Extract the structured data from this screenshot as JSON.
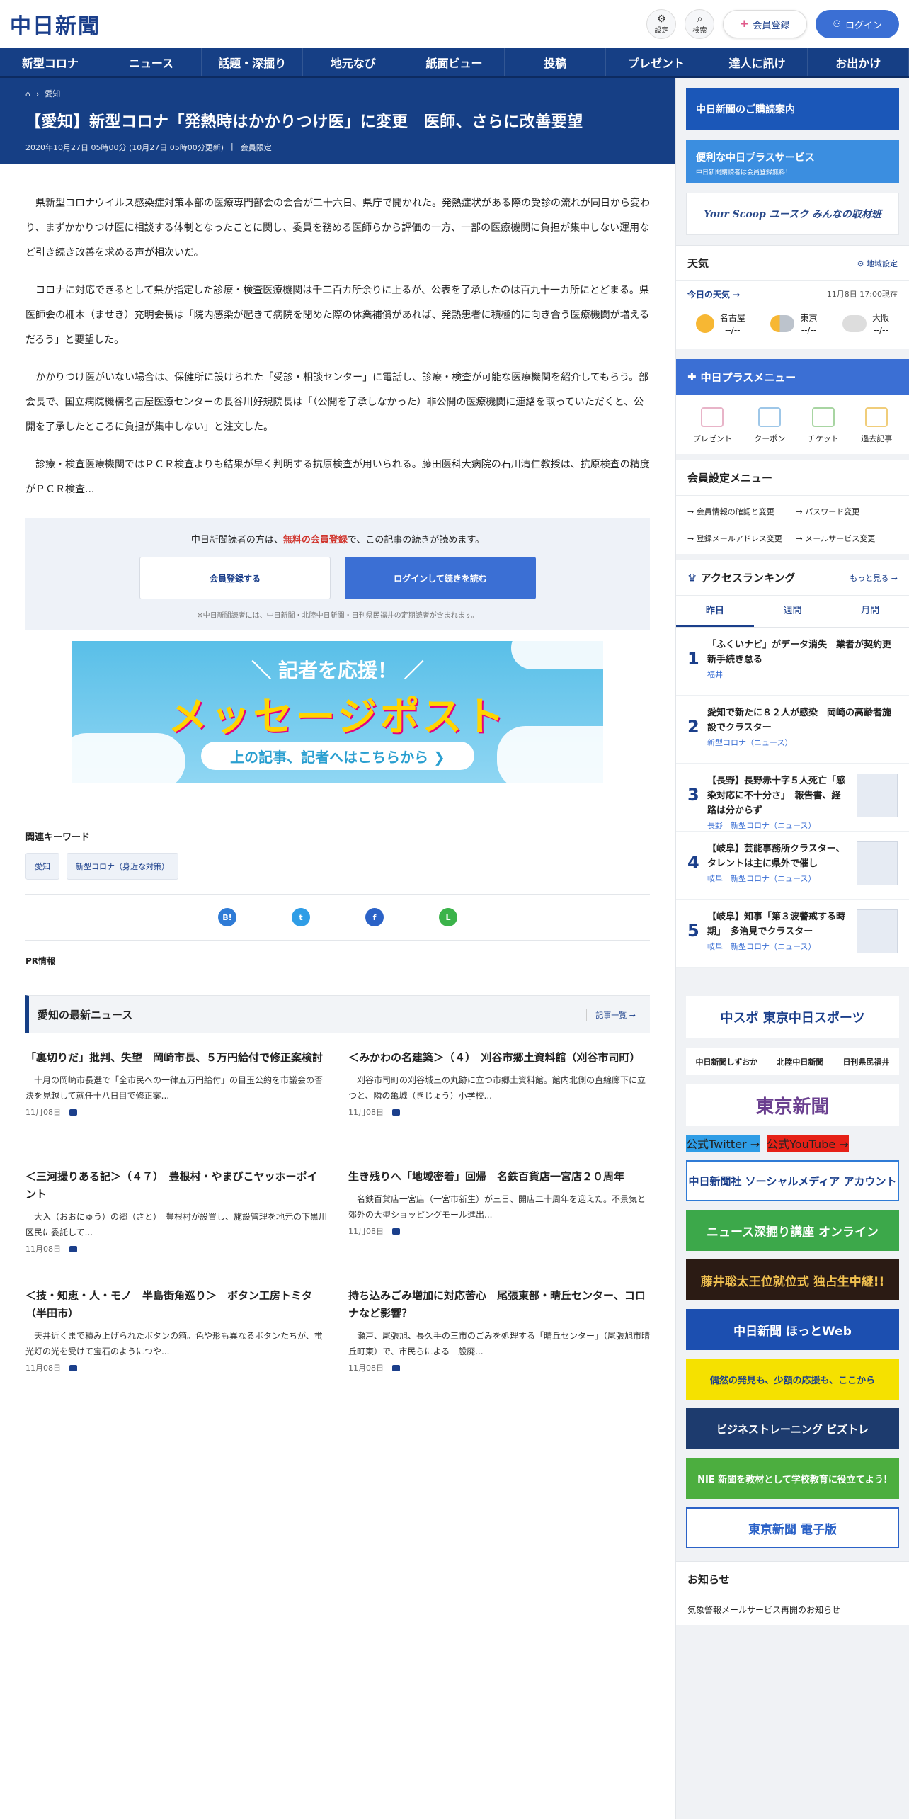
{
  "header": {
    "logo": "中日新聞",
    "settings_label": "設定",
    "search_label": "検索",
    "register_label": "会員登録",
    "login_label": "ログイン"
  },
  "nav": [
    "新型コロナ",
    "ニュース",
    "話題・深掘り",
    "地元なび",
    "紙面ビュー",
    "投稿",
    "プレゼント",
    "達人に訊け",
    "お出かけ"
  ],
  "breadcrumb": [
    "愛知"
  ],
  "article": {
    "title": "【愛知】新型コロナ「発熱時はかかりつけ医」に変更　医師、さらに改善要望",
    "date": "2020年10月27日 05時00分 (10月27日 05時00分更新)",
    "badge": "会員限定",
    "paragraphs": [
      "県新型コロナウイルス感染症対策本部の医療専門部会の会合が二十六日、県庁で開かれた。発熱症状がある際の受診の流れが同日から変わり、まずかかりつけ医に相談する体制となったことに関し、委員を務める医師らから評価の一方、一部の医療機関に負担が集中しない運用など引き続き改善を求める声が相次いだ。",
      "コロナに対応できるとして県が指定した診療・検査医療機関は千二百カ所余りに上るが、公表を了承したのは百九十一カ所にとどまる。県医師会の柵木（ませき）充明会長は「院内感染が起きて病院を閉めた際の休業補償があれば、発熱患者に積極的に向き合う医療機関が増えるだろう」と要望した。",
      "かかりつけ医がいない場合は、保健所に設けられた「受診・相談センター」に電話し、診療・検査が可能な医療機関を紹介してもらう。部会長で、国立病院機構名古屋医療センターの長谷川好規院長は「（公開を了承しなかった）非公開の医療機関に連絡を取っていただくと、公開を了承したところに負担が集中しない」と注文した。",
      "診療・検査医療機関ではＰＣＲ検査よりも結果が早く判明する抗原検査が用いられる。藤田医科大病院の石川清仁教授は、抗原検査の精度がＰＣＲ検査..."
    ]
  },
  "gate": {
    "lead_prefix": "中日新聞読者の方は、",
    "lead_red": "無料の会員登録",
    "lead_suffix": "で、この記事の続きが読めます。",
    "register_btn": "会員登録する",
    "login_btn": "ログインして続きを読む",
    "note": "※中日新聞読者には、中日新聞・北陸中日新聞・日刊県民福井の定期読者が含まれます。"
  },
  "banner": {
    "line1": "＼ 記者を応援！ ／",
    "line2": "メッセージポスト",
    "line3": "上の記事、記者へはこちらから ❯"
  },
  "keywords": {
    "heading": "関連キーワード",
    "tags": [
      "愛知",
      "新型コロナ（身近な対策）"
    ]
  },
  "share": [
    "B!",
    "t",
    "f",
    "L"
  ],
  "pr_label": "PR情報",
  "latest": {
    "heading": "愛知の最新ニュース",
    "more": "記事一覧 →",
    "items": [
      {
        "title": "「裏切りだ」批判、失望　岡崎市長、５万円給付で修正案検討",
        "lead": "十月の岡崎市長選で「全市民への一律五万円給付」の目玉公約を市議会の否決を見越して就任十八日目で修正案...",
        "date": "11月08日"
      },
      {
        "title": "＜みかわの名建築＞（４）　刈谷市郷土資料館（刈谷市司町）",
        "lead": "刈谷市司町の刈谷城三の丸跡に立つ市郷土資料館。館内北側の直線廊下に立つと、隣の亀城（きじょう）小学校...",
        "date": "11月08日"
      },
      {
        "title": "＜三河撮りある記＞（４７）　豊根村・やまびこヤッホーポイント",
        "lead": "大入（おおにゅう）の郷（さと）　豊根村が設置し、施設管理を地元の下黒川区民に委託して...",
        "date": "11月08日"
      },
      {
        "title": "生き残りへ「地域密着」回帰　名鉄百貨店一宮店２０周年",
        "lead": "名鉄百貨店一宮店（一宮市新生）が三日、開店二十周年を迎えた。不景気と郊外の大型ショッピングモール進出...",
        "date": "11月08日"
      },
      {
        "title": "＜技・知恵・人・モノ　半島街角巡り＞　ボタン工房トミタ（半田市）",
        "lead": "天井近くまで積み上げられたボタンの箱。色や形も異なるボタンたちが、蛍光灯の光を受けて宝石のようにつや...",
        "date": "11月08日"
      },
      {
        "title": "持ち込みごみ増加に対応苦心　尾張東部・晴丘センター、コロナなど影響？",
        "lead": "瀬戸、尾張旭、長久手の三市のごみを処理する「晴丘センター」（尾張旭市晴丘町東）で、市民らによる一般廃...",
        "date": "11月08日"
      }
    ]
  },
  "sidebar": {
    "banner1": "中日新聞のご購読案内",
    "banner2": "便利な中日プラスサービス",
    "banner2_sub": "中日新聞購読者は会員登録無料！",
    "banner3": "Your Scoop ユースク みんなの取材班",
    "weather": {
      "heading": "天気",
      "region_setting": "地域設定",
      "today": "今日の天気 →",
      "time": "11月8日 17:00現在",
      "cities": [
        {
          "name": "名古屋",
          "temp": "--/--"
        },
        {
          "name": "東京",
          "temp": "--/--"
        },
        {
          "name": "大阪",
          "temp": "--/--"
        }
      ]
    },
    "plus_menu": {
      "heading": "中日プラスメニュー",
      "items": [
        "プレゼント",
        "クーポン",
        "チケット",
        "過去記事"
      ]
    },
    "member_menu": {
      "heading": "会員設定メニュー",
      "items": [
        "会員情報の確認と変更",
        "パスワード変更",
        "登録メールアドレス変更",
        "メールサービス変更"
      ]
    },
    "ranking": {
      "heading": "アクセスランキング",
      "more": "もっと見る →",
      "tabs": [
        "昨日",
        "週間",
        "月間"
      ],
      "items": [
        {
          "rank": "1",
          "title": "「ふくいナビ」がデータ消失　業者が契約更新手続き怠る",
          "cat": "福井"
        },
        {
          "rank": "2",
          "title": "愛知で新たに８２人が感染　岡崎の高齢者施設でクラスター",
          "cat": "新型コロナ（ニュース）"
        },
        {
          "rank": "3",
          "title": "【長野】長野赤十字５人死亡「感染対応に不十分さ」　報告書、経路は分からず",
          "cat": "長野　新型コロナ（ニュース）"
        },
        {
          "rank": "4",
          "title": "【岐阜】芸能事務所クラスター、タレントは主に県外で催し",
          "cat": "岐阜　新型コロナ（ニュース）"
        },
        {
          "rank": "5",
          "title": "【岐阜】知事「第３波警戒する時期」　多治見でクラスター",
          "cat": "岐阜　新型コロナ（ニュース）"
        }
      ]
    },
    "chuspo": "中スポ 東京中日スポーツ",
    "links": [
      "中日新聞しずおか",
      "北陸中日新聞",
      "日刊県民福井"
    ],
    "tokyo": "東京新聞",
    "twitter": "公式Twitter →",
    "youtube": "公式YouTube →",
    "social": "中日新聞社 ソーシャルメディア アカウント",
    "ads": [
      "ニュース深掘り講座 オンライン",
      "藤井聡太王位就位式 独占生中継!!",
      "中日新聞 ほっとWeb",
      "偶然の発見も、少額の応援も、ここから",
      "ビジネストレーニング ビズトレ",
      "NIE 新聞を教材として学校教育に役立てよう!",
      "東京新聞 電子版"
    ],
    "notice": {
      "heading": "お知らせ",
      "item": "気象警報メールサービス再開のお知らせ"
    }
  },
  "colors": {
    "brand": "#163f85",
    "accent": "#3b6fd4",
    "red": "#d0342c"
  }
}
